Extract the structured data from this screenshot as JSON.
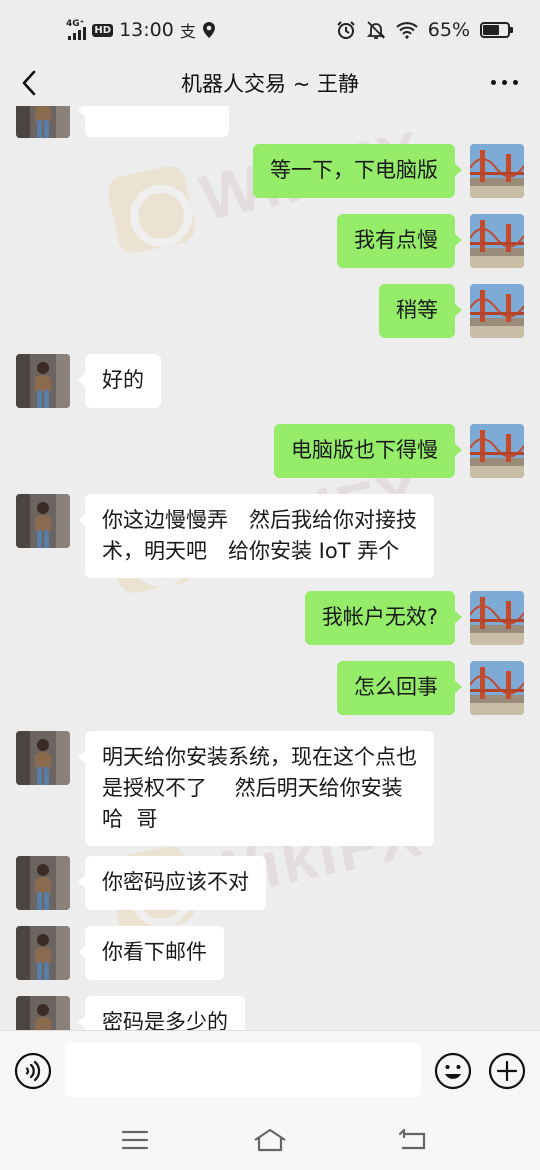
{
  "status_bar": {
    "network": "4G⁺",
    "hd": "HD",
    "time": "13:00",
    "app_glyph": "支",
    "battery_text": "65%",
    "battery_level": 0.65,
    "icons": [
      "signal-icon",
      "location-icon",
      "alarm-icon",
      "mute-icon",
      "wifi-icon",
      "battery-icon"
    ]
  },
  "nav": {
    "title": "机器人交易 ~ 王静",
    "back_icon": "chevron-left-icon",
    "more_icon": "more-icon"
  },
  "messages": [
    {
      "side": "in",
      "text": ""
    },
    {
      "side": "out",
      "text": "等一下，下电脑版"
    },
    {
      "side": "out",
      "text": "我有点慢"
    },
    {
      "side": "out",
      "text": "稍等"
    },
    {
      "side": "in",
      "text": "好的"
    },
    {
      "side": "out",
      "text": "电脑版也下得慢"
    },
    {
      "side": "in",
      "text": "你这边慢慢弄　然后我给你对接技\n术，明天吧　给你安装 IoT 弄个"
    },
    {
      "side": "out",
      "text": "我帐户无效?"
    },
    {
      "side": "out",
      "text": "怎么回事"
    },
    {
      "side": "in",
      "text": "明天给你安装系统，现在这个点也\n是授权不了　 然后明天给你安装\n哈  哥"
    },
    {
      "side": "in",
      "text": "你密码应该不对"
    },
    {
      "side": "in",
      "text": "你看下邮件"
    },
    {
      "side": "in",
      "text": "密码是多少的"
    }
  ],
  "watermark": {
    "text": "WikiFX"
  },
  "input_bar": {
    "value": "",
    "placeholder": "",
    "icons": [
      "voice-icon",
      "emoji-icon",
      "plus-icon"
    ]
  },
  "system_nav": {
    "icons": [
      "menu-icon",
      "home-icon",
      "back-icon"
    ]
  },
  "colors": {
    "background": "#ededed",
    "outgoing_bubble": "#95ec69",
    "incoming_bubble": "#ffffff"
  }
}
